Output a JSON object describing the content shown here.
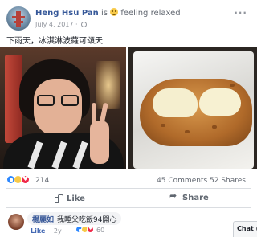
{
  "post": {
    "author": "Heng Hsu Pan",
    "is_word": "is",
    "feeling": "feeling relaxed",
    "date": "July 4, 2017 ·",
    "text": "下雨天，冰淇淋波蘿可頌天"
  },
  "stats": {
    "reaction_count": "214",
    "comments_shares": "45 Comments  52 Shares"
  },
  "actions": {
    "like": "Like",
    "share": "Share"
  },
  "comment": {
    "author": "楊麗如",
    "text": "我睡父吃飯94開心",
    "like": "Like",
    "time": "2y",
    "reaction_count": "60"
  },
  "chat": {
    "label": "Chat (1"
  },
  "icons": {
    "more": "more-options-icon",
    "privacy": "globe-icon",
    "like": "thumb-up-icon",
    "share": "share-arrow-icon"
  },
  "colors": {
    "link": "#365899",
    "like_blue": "#2d88ff",
    "love_red": "#f02849",
    "haha_yellow": "#f7c948"
  }
}
